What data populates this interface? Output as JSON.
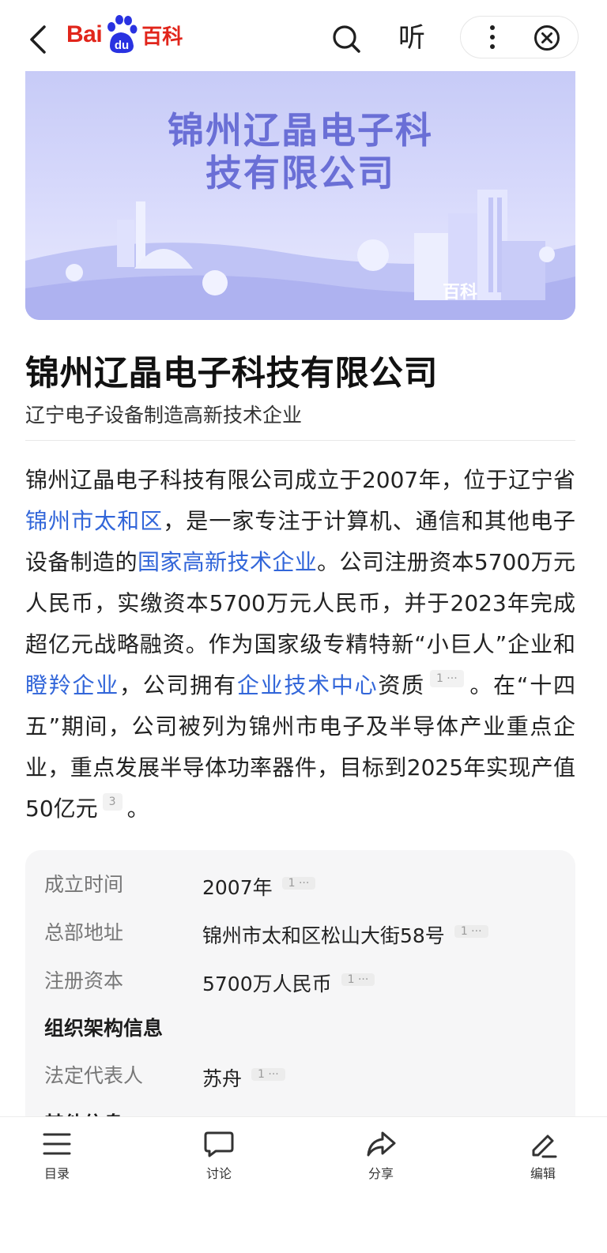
{
  "header": {
    "logo_text_latin": "Bai",
    "logo_text_du": "du",
    "logo_text_baike": "百科",
    "listen_label": "听"
  },
  "banner": {
    "title_line1": "锦州辽晶电子科",
    "title_line2": "技有限公司",
    "badge": "百科"
  },
  "article": {
    "title": "锦州辽晶电子科技有限公司",
    "subtitle": "辽宁电子设备制造高新技术企业",
    "summary": {
      "p1": "锦州辽晶电子科技有限公司成立于2007年，位于辽宁省",
      "link1": "锦州市太和区",
      "p2": "，是一家专注于计算机、通信和其他电子设备制造的",
      "link2": "国家高新技术企业",
      "p3": "。公司注册资本5700万元人民币，实缴资本5700万元人民币，并于2023年完成超亿元战略融资。作为国家级专精特新“小巨人”企业和",
      "link3": "瞪羚企业",
      "p4": "，公司拥有",
      "link4": "企业技术中心",
      "p5": "资质",
      "ref1": "1 ···",
      "p6": "。在“十四五”期间，公司被列为锦州市电子及半导体产业重点企业，重点发展半导体功率器件，目标到2025年实现产值50亿元",
      "ref2": "3",
      "p7": "。"
    }
  },
  "infobox": {
    "rows": [
      {
        "label": "成立时间",
        "value": "2007年",
        "ref": "1 ···"
      },
      {
        "label": "总部地址",
        "value": "锦州市太和区松山大街58号",
        "ref": "1 ···"
      },
      {
        "label": "注册资本",
        "value": "5700万人民币",
        "ref": "1 ···"
      }
    ],
    "group_title": "组织架构信息",
    "group_rows": [
      {
        "label": "法定代表人",
        "value": "苏舟",
        "ref": "1 ···"
      }
    ],
    "partial_next": "其他信息"
  },
  "bottom_nav": [
    {
      "label": "目录",
      "icon": "list-icon"
    },
    {
      "label": "讨论",
      "icon": "chat-bubble-icon"
    },
    {
      "label": "分享",
      "icon": "share-arrow-icon"
    },
    {
      "label": "编辑",
      "icon": "pencil-icon"
    }
  ],
  "colors": {
    "brand_red": "#e1251b",
    "brand_blue": "#2932e1",
    "link_blue": "#3266d9",
    "banner_text": "#6a6fd6"
  }
}
